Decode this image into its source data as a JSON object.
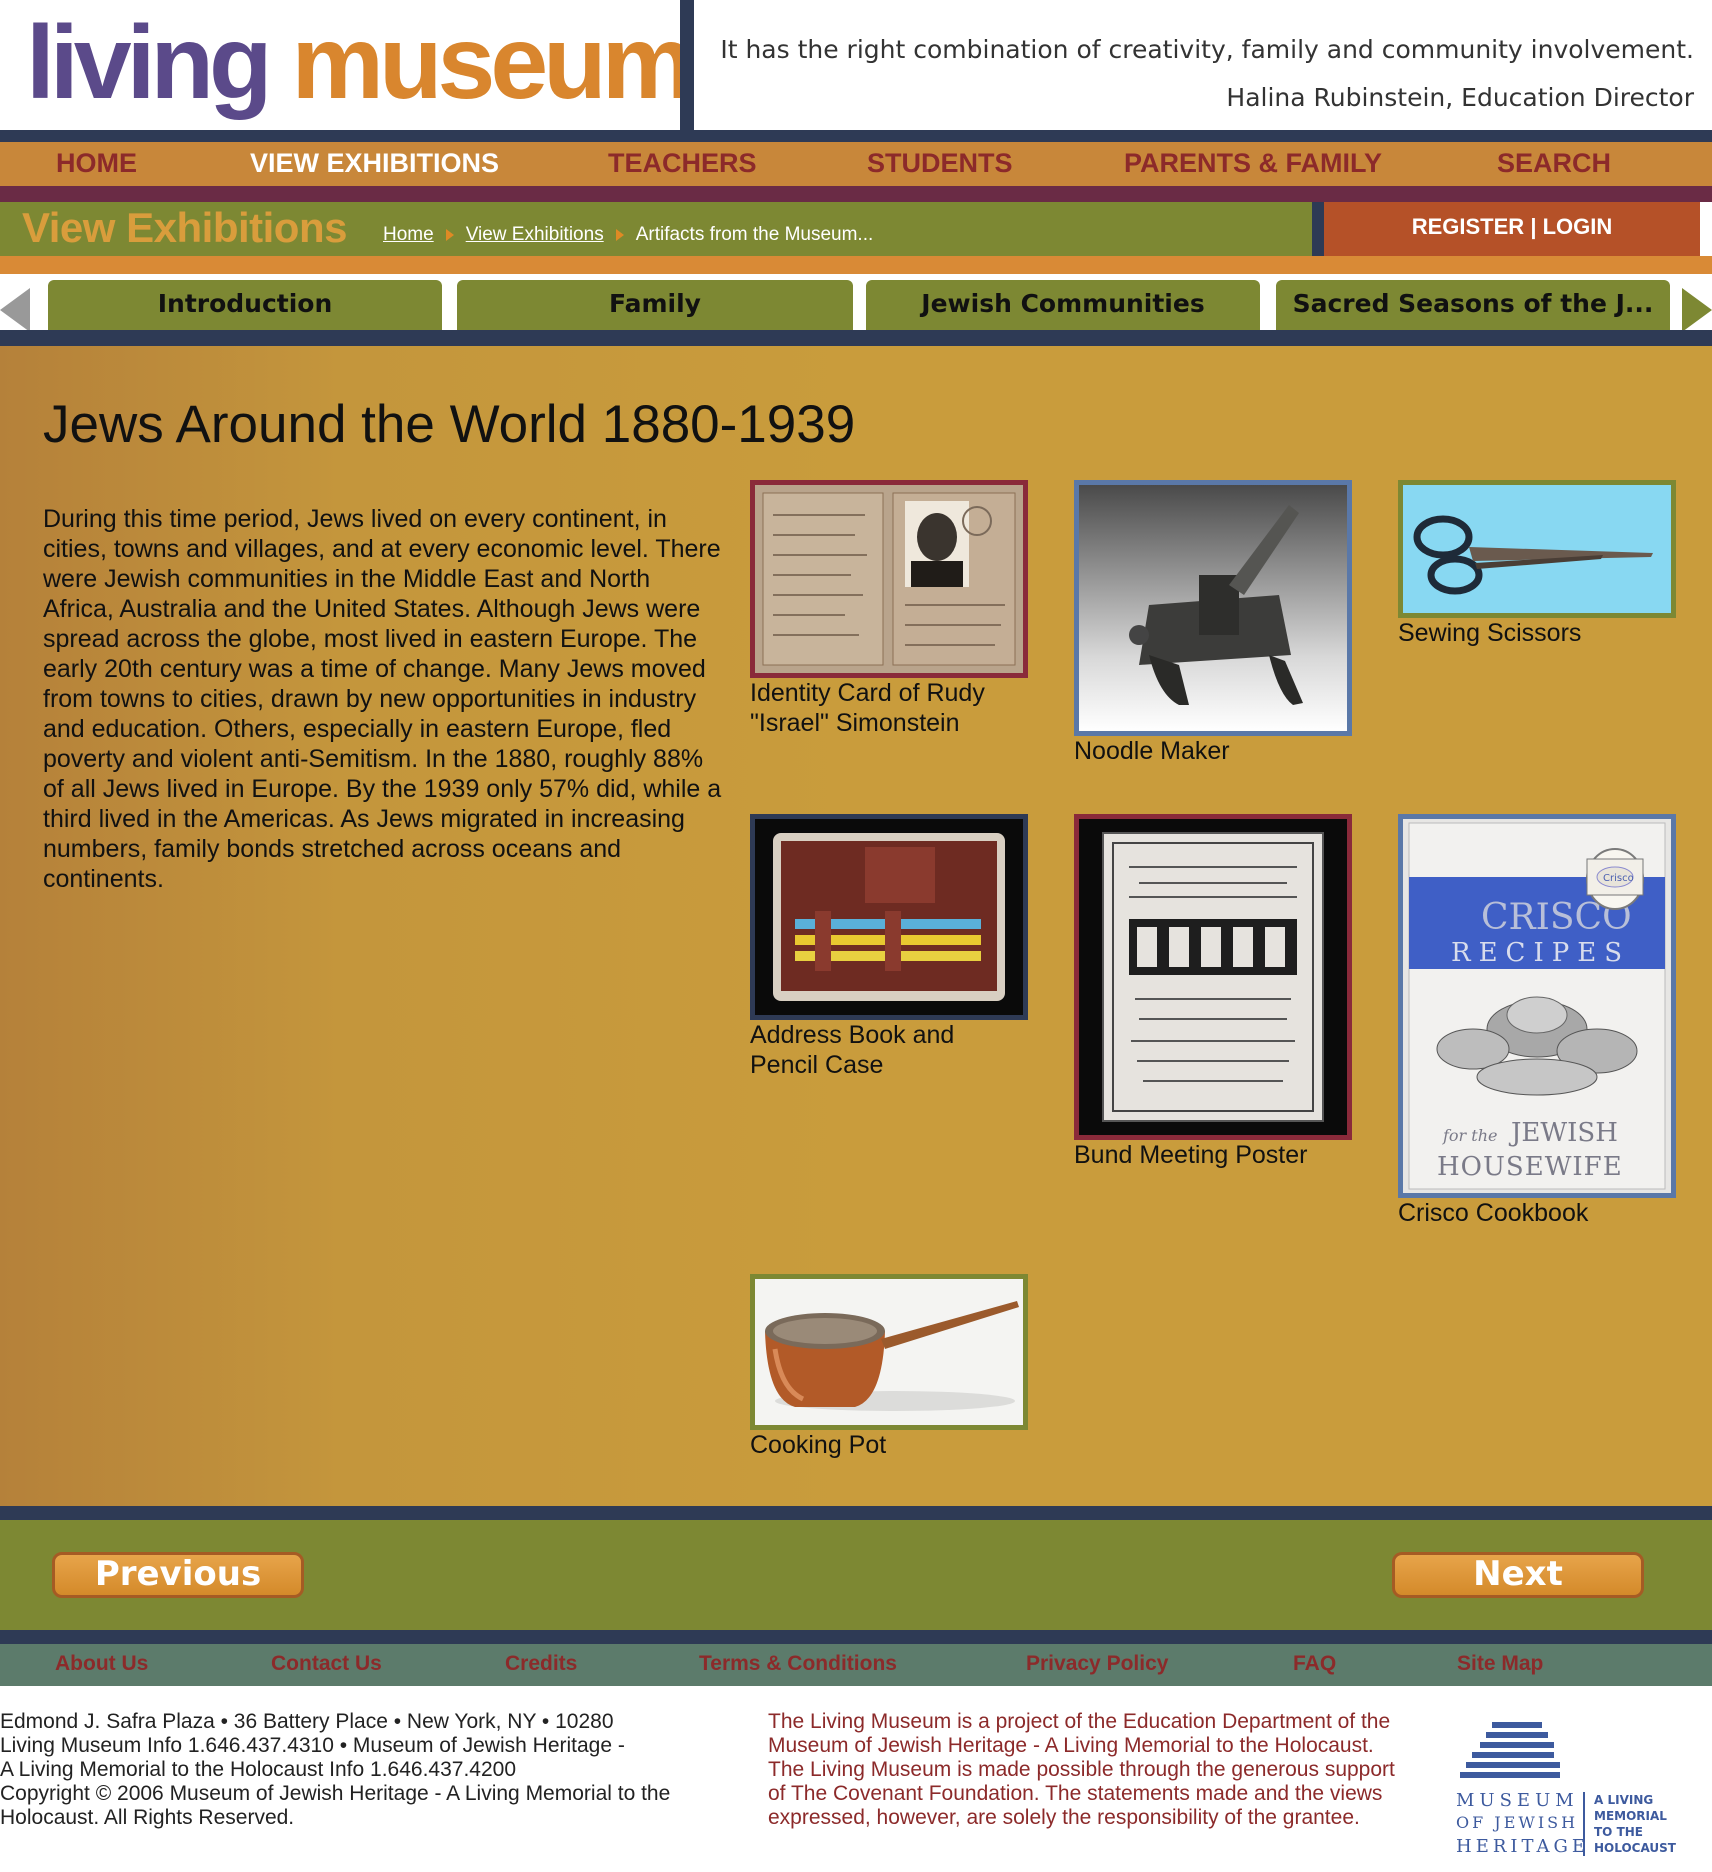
{
  "header": {
    "logo": {
      "part1": "living",
      "part2": "museum"
    },
    "quote": "It has the right combination of creativity, family and community involvement.",
    "attribution": "Halina Rubinstein, Education Director"
  },
  "nav": {
    "items": [
      "HOME",
      "VIEW EXHIBITIONS",
      "TEACHERS",
      "STUDENTS",
      "PARENTS & FAMILY",
      "SEARCH"
    ],
    "active": "VIEW EXHIBITIONS"
  },
  "titlebar": {
    "section": "View Exhibitions",
    "breadcrumb": [
      "Home",
      "View Exhibitions",
      "Artifacts from the Museum..."
    ],
    "register": "REGISTER",
    "separator": "|",
    "login": "LOGIN"
  },
  "tabs": [
    "Introduction",
    "Family",
    "Jewish Communities",
    "Sacred Seasons of the J..."
  ],
  "main": {
    "title": "Jews Around the World 1880-1939",
    "intro": "During this time period, Jews lived on every continent, in cities, towns and villages, and at every economic level. There were Jewish communities in the Middle East and North Africa, Australia and the United States. Although Jews were spread across the globe, most lived in eastern Europe. The early 20th century was a time of change. Many Jews moved from towns to cities, drawn by new opportunities in industry and education. Others, especially in eastern Europe, fled poverty and violent anti-Semitism. In the 1880, roughly 88% of all Jews lived in Europe. By the 1939 only 57% did, while a third lived in the Americas. As Jews migrated in increasing numbers, family bonds stretched across oceans and continents.",
    "artifacts": [
      {
        "caption": "Identity Card of Rudy \"Israel\" Simonstein",
        "border": "#8a2a3a"
      },
      {
        "caption": "Noodle Maker",
        "border": "#5a78a8"
      },
      {
        "caption": "Sewing Scissors",
        "border": "#7d8833"
      },
      {
        "caption": "Address Book and Pencil Case",
        "border": "#2e3a55"
      },
      {
        "caption": "Bund Meeting Poster",
        "border": "#8a2a3a"
      },
      {
        "caption": "Crisco Cookbook",
        "border": "#5a78a8"
      },
      {
        "caption": "Cooking Pot",
        "border": "#7d8833"
      }
    ],
    "crisco_text": {
      "title": "CRISCO",
      "subtitle": "RECIPES",
      "for": "for the",
      "line1": "JEWISH",
      "line2": "HOUSEWIFE",
      "can": "Crisco"
    }
  },
  "pager": {
    "previous": "Previous",
    "next": "Next"
  },
  "footer": {
    "links": [
      "About Us",
      "Contact Us",
      "Credits",
      "Terms & Conditions",
      "Privacy Policy",
      "FAQ",
      "Site Map"
    ],
    "address_lines": [
      "Edmond J. Safra Plaza • 36 Battery Place • New York, NY • 10280",
      "Living Museum Info 1.646.437.4310 • Museum of Jewish Heritage -",
      "A Living Memorial to the Holocaust Info 1.646.437.4200",
      "Copyright © 2006 Museum of Jewish Heritage - A Living Memorial to the",
      "Holocaust. All Rights Reserved."
    ],
    "project_lines": [
      "The Living Museum is a project of the Education Department of the",
      "Museum of Jewish Heritage - A Living Memorial to the Holocaust.",
      "The Living Museum is made possible through the generous support",
      "of The Covenant Foundation. The statements made and the views",
      "expressed, however, are solely the responsibility of the grantee."
    ],
    "mjh_logo": {
      "left": [
        "MUSEUM",
        "OF JEWISH",
        "HERITAGE"
      ],
      "right": [
        "A LIVING",
        "MEMORIAL",
        "TO THE",
        "HOLOCAUST"
      ]
    }
  },
  "colors": {
    "navy": "#2e3a55",
    "olive": "#7d8833",
    "orange": "#c8873a",
    "maroon": "#8c2a2a",
    "mustard": "#c99c3c"
  }
}
